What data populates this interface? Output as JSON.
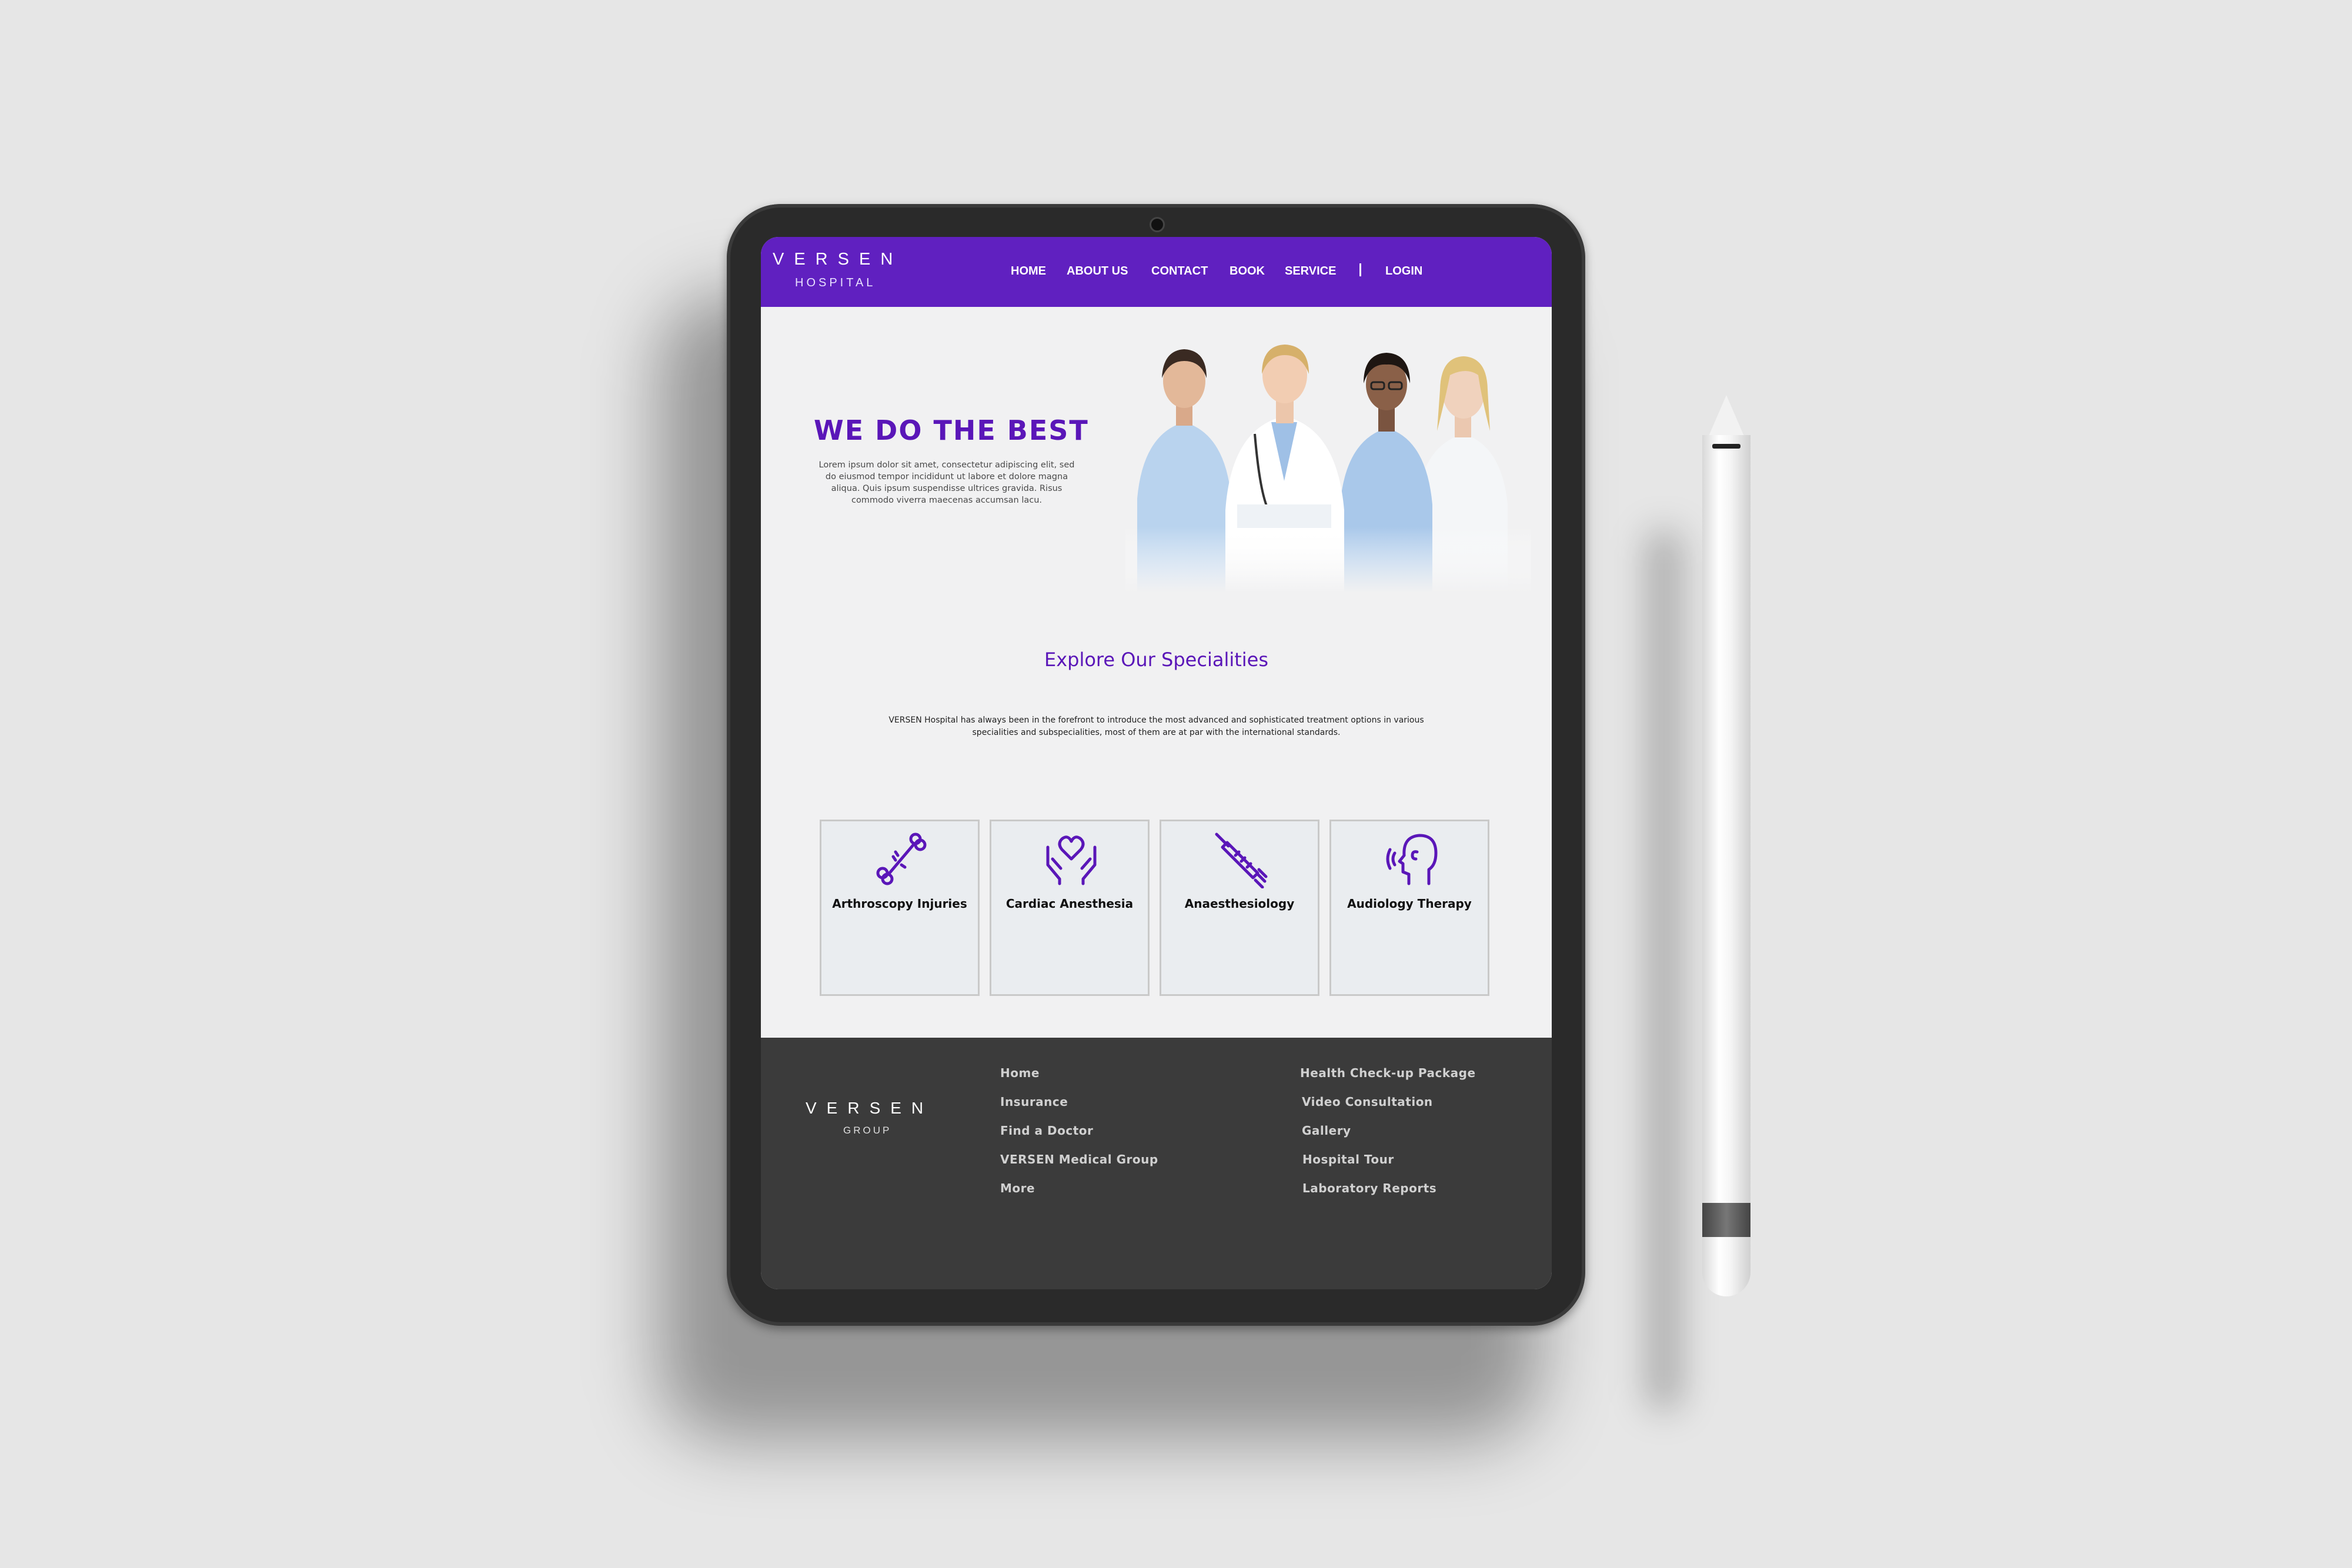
{
  "header": {
    "logo": "VERSEN",
    "logo_sub": "HOSPITAL",
    "nav": [
      "HOME",
      "ABOUT US",
      "CONTACT",
      "BOOK",
      "SERVICE",
      "LOGIN"
    ]
  },
  "hero": {
    "title": "WE DO THE BEST",
    "text": "Lorem ipsum dolor sit amet, consectetur adipiscing elit, sed do eiusmod tempor incididunt ut labore et dolore magna aliqua. Quis ipsum suspendisse ultrices gravida. Risus commodo viverra maecenas accumsan lacu."
  },
  "specialities": {
    "title": "Explore Our Specialities",
    "text": "VERSEN Hospital has always been in the forefront to introduce the most advanced and sophisticated treatment options in various specialities and subspecialities, most of them are at par with the international standards.",
    "cards": [
      {
        "label": "Arthroscopy Injuries",
        "icon": "bone-icon"
      },
      {
        "label": "Cardiac Anesthesia",
        "icon": "heart-hands-icon"
      },
      {
        "label": "Anaesthesiology",
        "icon": "syringe-icon"
      },
      {
        "label": "Audiology Therapy",
        "icon": "head-sound-icon"
      }
    ]
  },
  "footer": {
    "logo": "VERSEN",
    "logo_sub": "GROUP",
    "links_left": [
      "Home",
      "Insurance",
      "Find a Doctor",
      "VERSEN Medical Group",
      "More"
    ],
    "links_right": [
      "Health Check-up Package",
      "Video Consultation",
      "Gallery",
      "Hospital Tour",
      "Laboratory Reports"
    ]
  },
  "colors": {
    "brand": "#6020c0",
    "accent_text": "#5a16b8",
    "footer_bg": "#3b3b3b",
    "page_bg": "#f1f1f2"
  }
}
